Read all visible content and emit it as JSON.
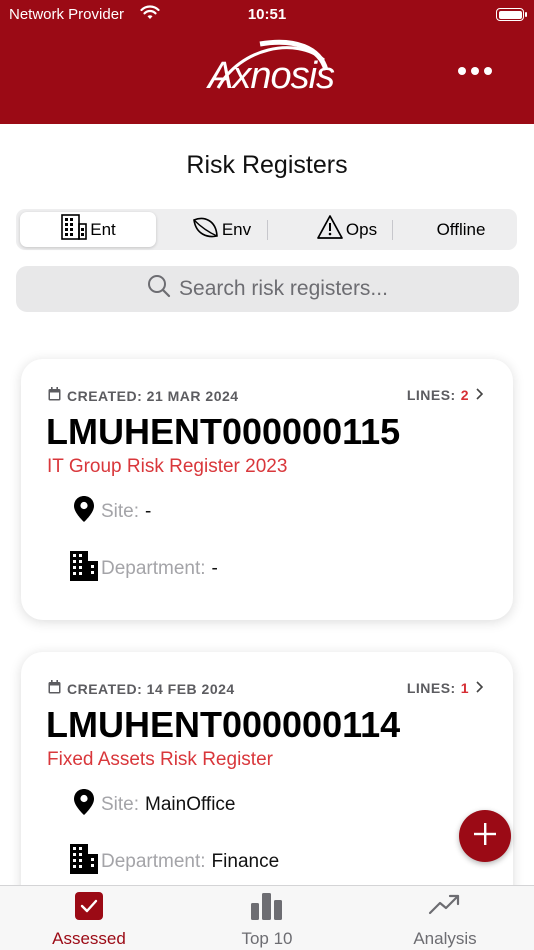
{
  "status_bar": {
    "carrier": "Network Provider",
    "time": "10:51"
  },
  "header": {
    "logo_text": "Axnosis",
    "menu_icon": "more-horizontal-icon"
  },
  "page": {
    "title": "Risk Registers"
  },
  "segments": [
    {
      "label": "Ent",
      "icon": "building-icon",
      "active": true
    },
    {
      "label": "Env",
      "icon": "leaf-icon",
      "active": false
    },
    {
      "label": "Ops",
      "icon": "warning-icon",
      "active": false
    },
    {
      "label": "Offline",
      "active": false
    }
  ],
  "search": {
    "placeholder": "Search risk registers..."
  },
  "cards": [
    {
      "created": "CREATED: 21 MAR 2024",
      "lines_label": "LINES:",
      "lines_count": "2",
      "id": "LMUHENT000000115",
      "name": "IT Group Risk Register 2023",
      "site_label": "Site:",
      "site_value": "-",
      "dept_label": "Department:",
      "dept_value": "-"
    },
    {
      "created": "CREATED: 14 FEB 2024",
      "lines_label": "LINES:",
      "lines_count": "1",
      "id": "LMUHENT000000114",
      "name": "Fixed Assets Risk Register",
      "site_label": "Site:",
      "site_value": "MainOffice",
      "dept_label": "Department:",
      "dept_value": "Finance"
    }
  ],
  "tabbar": [
    {
      "label": "Assessed",
      "icon": "checkbox-icon",
      "active": true
    },
    {
      "label": "Top 10",
      "icon": "bar-chart-icon",
      "active": false
    },
    {
      "label": "Analysis",
      "icon": "trending-up-icon",
      "active": false
    }
  ],
  "colors": {
    "brand": "#9b0a15",
    "accent_red": "#d9373b",
    "background": "#ffffff"
  }
}
